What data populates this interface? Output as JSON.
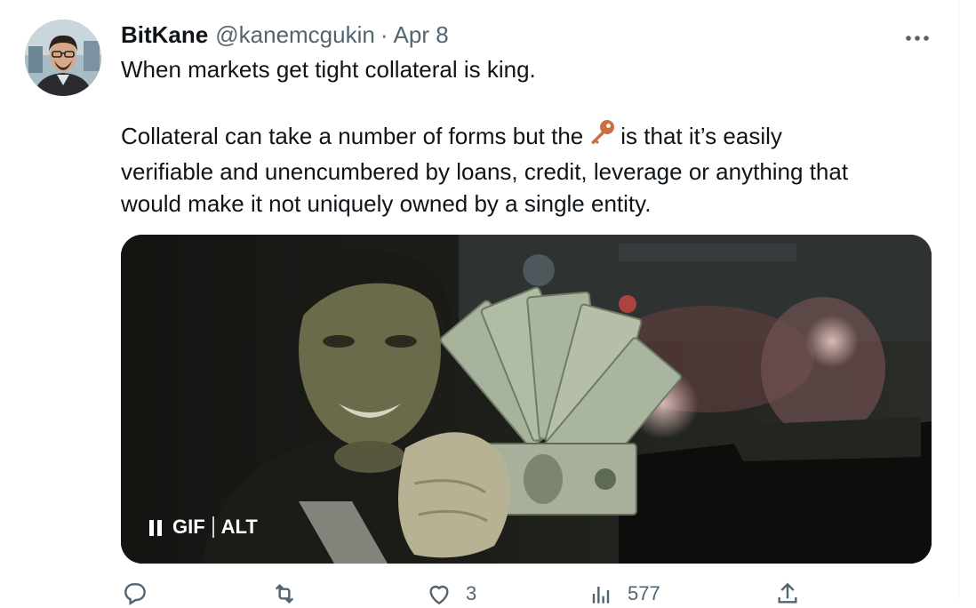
{
  "tweet": {
    "author_name": "BitKane",
    "handle": "@kanemcgukin",
    "separator": "·",
    "date": "Apr 8",
    "more_label": "•••",
    "line1": "When markets get tight collateral is king.",
    "line2_before_icon": "Collateral can take a number of forms but the",
    "line2_after_icon": "is that it’s easily",
    "line3": "verifiable and unencumbered by loans, credit, leverage or anything that",
    "line4": "would make it not uniquely owned by a single entity.",
    "inline_icon": "key-icon"
  },
  "media": {
    "type": "gif",
    "gif_label": "GIF",
    "alt_label": "ALT",
    "pause_icon": "pause-icon"
  },
  "actions": {
    "reply": {
      "icon": "reply-icon",
      "count": ""
    },
    "retweet": {
      "icon": "retweet-icon",
      "count": ""
    },
    "like": {
      "icon": "heart-icon",
      "count": "3"
    },
    "views": {
      "icon": "analytics-icon",
      "count": "577"
    },
    "share": {
      "icon": "share-icon",
      "count": ""
    }
  },
  "colors": {
    "text": "#0f1419",
    "secondary": "#536471",
    "key_icon": "#c8703f"
  }
}
